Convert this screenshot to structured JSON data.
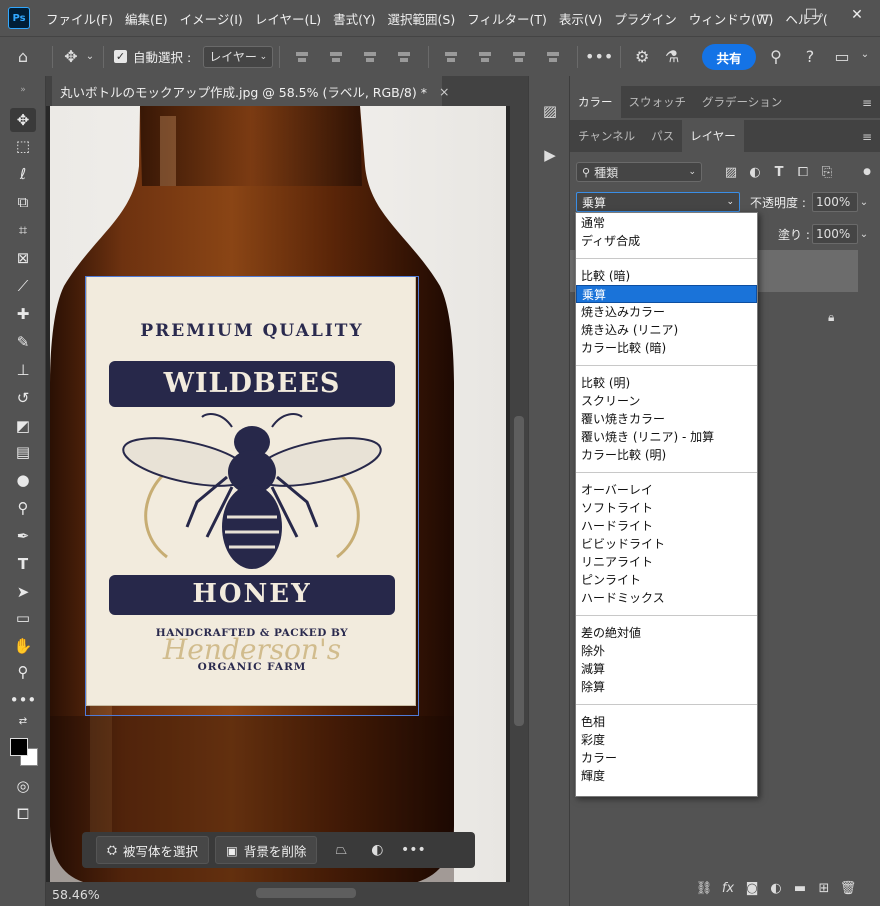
{
  "menubar": {
    "logo": "Ps",
    "items": [
      "ファイル(F)",
      "編集(E)",
      "イメージ(I)",
      "レイヤー(L)",
      "書式(Y)",
      "選択範囲(S)",
      "フィルター(T)",
      "表示(V)",
      "プラグイン",
      "ウィンドウ(W)",
      "ヘルプ("
    ],
    "window_controls": [
      "—",
      "☐",
      "✕"
    ]
  },
  "options": {
    "auto_select_label": "自動選択 :",
    "auto_select_target": "レイヤー",
    "share_label": "共有"
  },
  "document": {
    "tab_title": "丸いボトルのモックアップ作成.jpg @ 58.5% (ラベル, RGB/8) *",
    "close_glyph": "×",
    "zoom": "58.46%"
  },
  "label_art": {
    "premium": "PREMIUM QUALITY",
    "brand": "WILDBEES",
    "product": "HONEY",
    "crafted": "HANDCRAFTED & PACKED BY",
    "script": "Henderson's",
    "farm": "ORGANIC FARM"
  },
  "context_bar": {
    "select_subject": "被写体を選択",
    "remove_background": "背景を削除"
  },
  "panels": {
    "top_tabs": [
      "カラー",
      "スウォッチ",
      "グラデーション"
    ],
    "layer_tabs": [
      "チャンネル",
      "パス",
      "レイヤー"
    ],
    "kind_filter": "種類",
    "blend_mode": "乗算",
    "opacity_label": "不透明度 :",
    "opacity_value": "100%",
    "fill_label": "塗り :",
    "fill_value": "100%"
  },
  "blend_modes": {
    "group1": [
      "通常",
      "ディザ合成"
    ],
    "group2": [
      "比較 (暗)",
      "乗算",
      "焼き込みカラー",
      "焼き込み (リニア)",
      "カラー比較 (暗)"
    ],
    "group3": [
      "比較 (明)",
      "スクリーン",
      "覆い焼きカラー",
      "覆い焼き (リニア) - 加算",
      "カラー比較 (明)"
    ],
    "group4": [
      "オーバーレイ",
      "ソフトライト",
      "ハードライト",
      "ビビッドライト",
      "リニアライト",
      "ピンライト",
      "ハードミックス"
    ],
    "group5": [
      "差の絶対値",
      "除外",
      "減算",
      "除算"
    ],
    "group6": [
      "色相",
      "彩度",
      "カラー",
      "輝度"
    ],
    "selected": "乗算"
  },
  "colors": {
    "accent": "#1473e6",
    "selected_item": "#1a73d9",
    "panel_bg": "#535353",
    "label_navy": "#27284a",
    "label_gold": "#c7ad73"
  }
}
